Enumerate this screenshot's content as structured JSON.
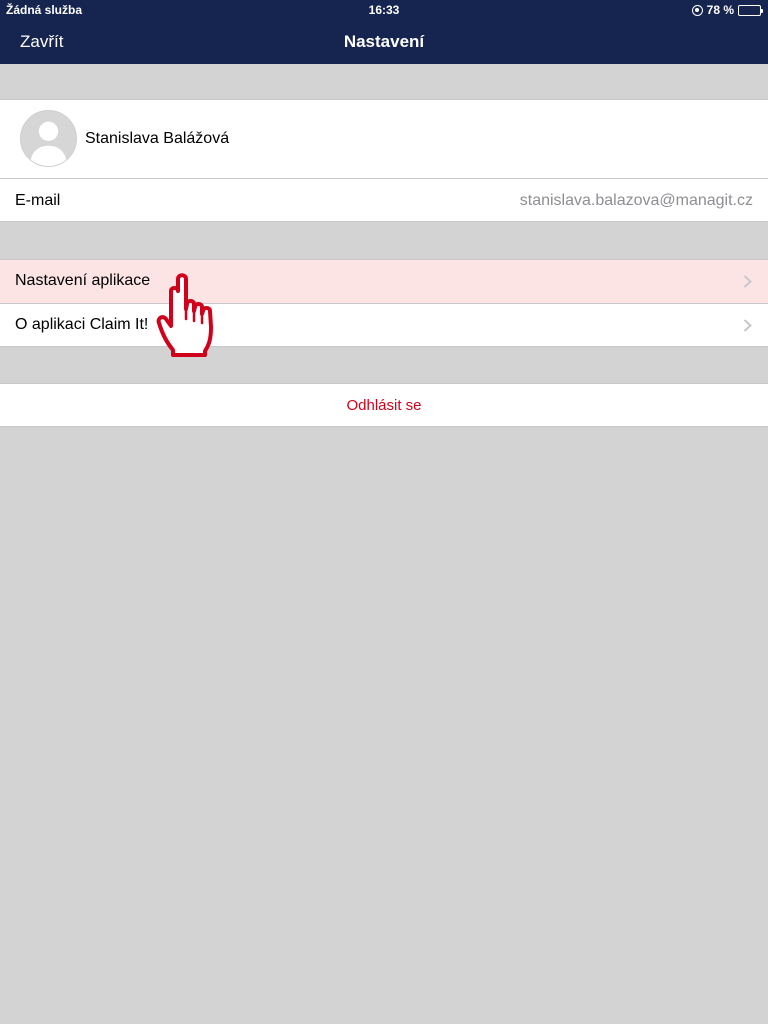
{
  "status_bar": {
    "carrier": "Žádná služba",
    "time": "16:33",
    "battery": "78 %",
    "battery_level": 0.78,
    "icons": [
      "rotation-lock-icon",
      "battery-icon"
    ]
  },
  "nav_bar": {
    "close_label": "Zavřít",
    "title": "Nastavení"
  },
  "profile": {
    "name": "Stanislava Balážová",
    "avatar_icon": "person-silhouette-icon"
  },
  "email": {
    "label": "E-mail",
    "value": "stanislava.balazova@managit.cz"
  },
  "menu": {
    "items": [
      {
        "label": "Nastavení aplikace",
        "highlighted": true
      },
      {
        "label": "O aplikaci Claim It!",
        "highlighted": false
      }
    ]
  },
  "logout": {
    "label": "Odhlásit se"
  },
  "colors": {
    "nav_background": "#16254f",
    "screen_background": "#d3d3d3",
    "highlight_row": "#fce4e4",
    "logout_text": "#d0021b",
    "pointer_outline": "#d0021b"
  },
  "pointer_icon": "hand-pointer-icon"
}
